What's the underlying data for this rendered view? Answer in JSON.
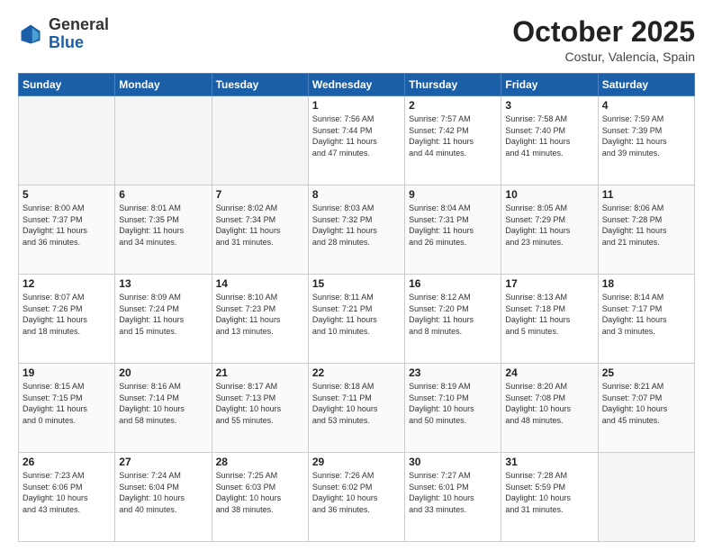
{
  "header": {
    "logo_general": "General",
    "logo_blue": "Blue",
    "month_title": "October 2025",
    "location": "Costur, Valencia, Spain"
  },
  "weekdays": [
    "Sunday",
    "Monday",
    "Tuesday",
    "Wednesday",
    "Thursday",
    "Friday",
    "Saturday"
  ],
  "weeks": [
    [
      {
        "day": "",
        "info": ""
      },
      {
        "day": "",
        "info": ""
      },
      {
        "day": "",
        "info": ""
      },
      {
        "day": "1",
        "info": "Sunrise: 7:56 AM\nSunset: 7:44 PM\nDaylight: 11 hours\nand 47 minutes."
      },
      {
        "day": "2",
        "info": "Sunrise: 7:57 AM\nSunset: 7:42 PM\nDaylight: 11 hours\nand 44 minutes."
      },
      {
        "day": "3",
        "info": "Sunrise: 7:58 AM\nSunset: 7:40 PM\nDaylight: 11 hours\nand 41 minutes."
      },
      {
        "day": "4",
        "info": "Sunrise: 7:59 AM\nSunset: 7:39 PM\nDaylight: 11 hours\nand 39 minutes."
      }
    ],
    [
      {
        "day": "5",
        "info": "Sunrise: 8:00 AM\nSunset: 7:37 PM\nDaylight: 11 hours\nand 36 minutes."
      },
      {
        "day": "6",
        "info": "Sunrise: 8:01 AM\nSunset: 7:35 PM\nDaylight: 11 hours\nand 34 minutes."
      },
      {
        "day": "7",
        "info": "Sunrise: 8:02 AM\nSunset: 7:34 PM\nDaylight: 11 hours\nand 31 minutes."
      },
      {
        "day": "8",
        "info": "Sunrise: 8:03 AM\nSunset: 7:32 PM\nDaylight: 11 hours\nand 28 minutes."
      },
      {
        "day": "9",
        "info": "Sunrise: 8:04 AM\nSunset: 7:31 PM\nDaylight: 11 hours\nand 26 minutes."
      },
      {
        "day": "10",
        "info": "Sunrise: 8:05 AM\nSunset: 7:29 PM\nDaylight: 11 hours\nand 23 minutes."
      },
      {
        "day": "11",
        "info": "Sunrise: 8:06 AM\nSunset: 7:28 PM\nDaylight: 11 hours\nand 21 minutes."
      }
    ],
    [
      {
        "day": "12",
        "info": "Sunrise: 8:07 AM\nSunset: 7:26 PM\nDaylight: 11 hours\nand 18 minutes."
      },
      {
        "day": "13",
        "info": "Sunrise: 8:09 AM\nSunset: 7:24 PM\nDaylight: 11 hours\nand 15 minutes."
      },
      {
        "day": "14",
        "info": "Sunrise: 8:10 AM\nSunset: 7:23 PM\nDaylight: 11 hours\nand 13 minutes."
      },
      {
        "day": "15",
        "info": "Sunrise: 8:11 AM\nSunset: 7:21 PM\nDaylight: 11 hours\nand 10 minutes."
      },
      {
        "day": "16",
        "info": "Sunrise: 8:12 AM\nSunset: 7:20 PM\nDaylight: 11 hours\nand 8 minutes."
      },
      {
        "day": "17",
        "info": "Sunrise: 8:13 AM\nSunset: 7:18 PM\nDaylight: 11 hours\nand 5 minutes."
      },
      {
        "day": "18",
        "info": "Sunrise: 8:14 AM\nSunset: 7:17 PM\nDaylight: 11 hours\nand 3 minutes."
      }
    ],
    [
      {
        "day": "19",
        "info": "Sunrise: 8:15 AM\nSunset: 7:15 PM\nDaylight: 11 hours\nand 0 minutes."
      },
      {
        "day": "20",
        "info": "Sunrise: 8:16 AM\nSunset: 7:14 PM\nDaylight: 10 hours\nand 58 minutes."
      },
      {
        "day": "21",
        "info": "Sunrise: 8:17 AM\nSunset: 7:13 PM\nDaylight: 10 hours\nand 55 minutes."
      },
      {
        "day": "22",
        "info": "Sunrise: 8:18 AM\nSunset: 7:11 PM\nDaylight: 10 hours\nand 53 minutes."
      },
      {
        "day": "23",
        "info": "Sunrise: 8:19 AM\nSunset: 7:10 PM\nDaylight: 10 hours\nand 50 minutes."
      },
      {
        "day": "24",
        "info": "Sunrise: 8:20 AM\nSunset: 7:08 PM\nDaylight: 10 hours\nand 48 minutes."
      },
      {
        "day": "25",
        "info": "Sunrise: 8:21 AM\nSunset: 7:07 PM\nDaylight: 10 hours\nand 45 minutes."
      }
    ],
    [
      {
        "day": "26",
        "info": "Sunrise: 7:23 AM\nSunset: 6:06 PM\nDaylight: 10 hours\nand 43 minutes."
      },
      {
        "day": "27",
        "info": "Sunrise: 7:24 AM\nSunset: 6:04 PM\nDaylight: 10 hours\nand 40 minutes."
      },
      {
        "day": "28",
        "info": "Sunrise: 7:25 AM\nSunset: 6:03 PM\nDaylight: 10 hours\nand 38 minutes."
      },
      {
        "day": "29",
        "info": "Sunrise: 7:26 AM\nSunset: 6:02 PM\nDaylight: 10 hours\nand 36 minutes."
      },
      {
        "day": "30",
        "info": "Sunrise: 7:27 AM\nSunset: 6:01 PM\nDaylight: 10 hours\nand 33 minutes."
      },
      {
        "day": "31",
        "info": "Sunrise: 7:28 AM\nSunset: 5:59 PM\nDaylight: 10 hours\nand 31 minutes."
      },
      {
        "day": "",
        "info": ""
      }
    ]
  ]
}
